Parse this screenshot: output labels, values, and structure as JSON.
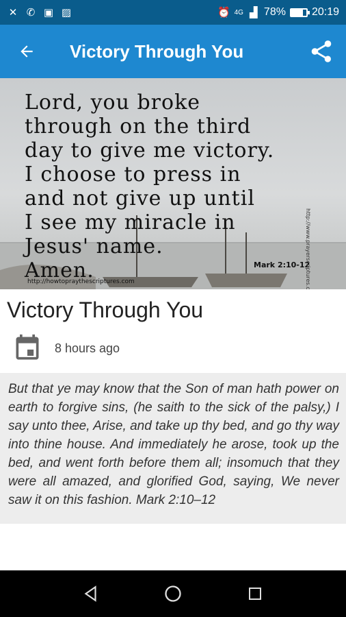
{
  "status_bar": {
    "icons": [
      "missed-call-icon",
      "whatsapp-icon",
      "bag-icon",
      "image-icon"
    ],
    "signal_label": "4G",
    "battery_percent": "78%",
    "battery_level": 0.78,
    "time": "20:19"
  },
  "appbar": {
    "title": "Victory Through You",
    "back_icon": "arrow-back-icon",
    "share_icon": "share-icon"
  },
  "hero": {
    "prayer_text": "Lord, you broke\nthrough on the third\nday to give me victory.\nI choose to press in\nand not give up until\nI see my miracle in\nJesus' name.\nAmen.",
    "reference": "Mark 2:10-12",
    "url": "http://howtopraythescriptures.com",
    "side_url": "http://www.prayerscriptures.com"
  },
  "post": {
    "title": "Victory Through You",
    "time_ago": "8 hours ago",
    "body": "But that ye may know that the Son of man hath power on earth to forgive sins, (he saith to the sick of the palsy,) I say unto thee, Arise, and take up thy bed, and go thy way into thine house. And immediately he arose, took up the bed, and went forth before them all; insomuch that they were all amazed, and glorified God, saying, We never saw it on this fashion. Mark 2:10–12"
  },
  "colors": {
    "status_bar": "#0a5c8c",
    "app_bar": "#1e88d0",
    "content_bg": "#ededed"
  }
}
